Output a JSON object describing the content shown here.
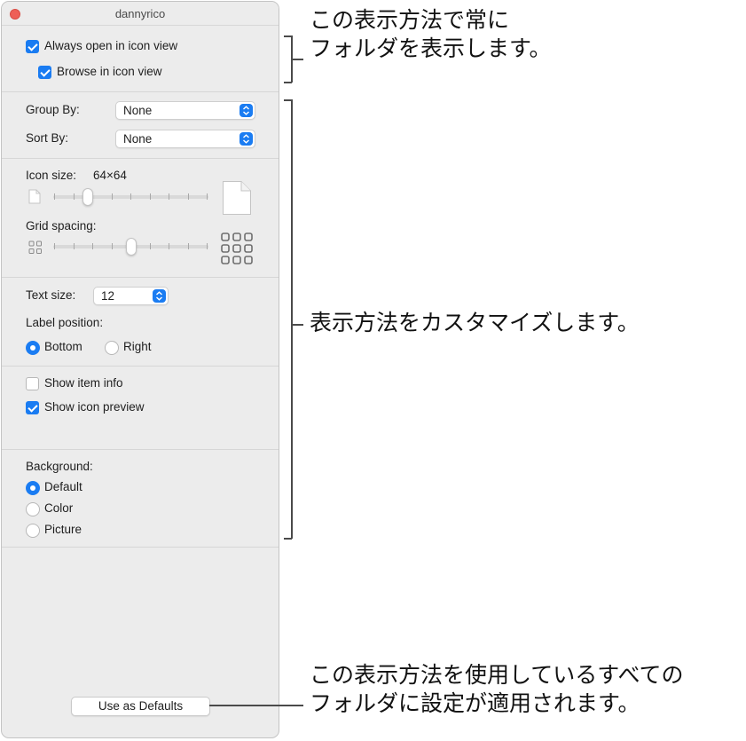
{
  "window": {
    "title": "dannyrico",
    "always_open_label": "Always open in icon view",
    "browse_label": "Browse in icon view",
    "group_by_label": "Group By:",
    "group_by_value": "None",
    "sort_by_label": "Sort By:",
    "sort_by_value": "None",
    "icon_size_label": "Icon size:",
    "icon_size_value": "64×64",
    "icon_size_level": 0.2,
    "grid_spacing_label": "Grid spacing:",
    "grid_spacing_level": 0.5,
    "text_size_label": "Text size:",
    "text_size_value": "12",
    "label_position_label": "Label position:",
    "label_bottom": "Bottom",
    "label_right": "Right",
    "show_item_info": "Show item info",
    "show_icon_preview": "Show icon preview",
    "background_label": "Background:",
    "bg_default": "Default",
    "bg_color": "Color",
    "bg_picture": "Picture",
    "use_defaults_button": "Use as Defaults"
  },
  "annotations": {
    "top_line1": "この表示方法で常に",
    "top_line2": "フォルダを表示します。",
    "middle": "表示方法をカスタマイズします。",
    "bottom_line1": "この表示方法を使用しているすべての",
    "bottom_line2": "フォルダに設定が適用されます。"
  },
  "colors": {
    "accent": "#1a7cf2",
    "close": "#ee5f57"
  }
}
